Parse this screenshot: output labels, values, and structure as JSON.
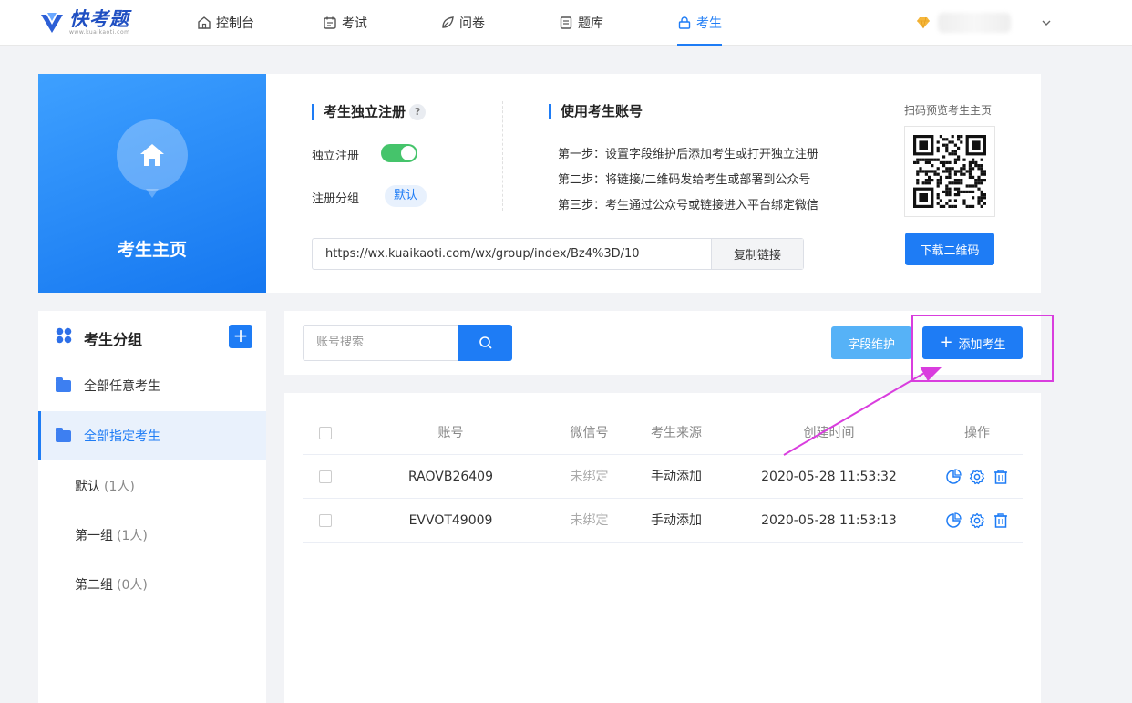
{
  "nav": {
    "logo_name": "快考题",
    "logo_sub": "www.kuaikaoti.com",
    "items": [
      {
        "label": "控制台",
        "icon": "home-icon"
      },
      {
        "label": "考试",
        "icon": "calendar-icon"
      },
      {
        "label": "问卷",
        "icon": "leaf-icon"
      },
      {
        "label": "题库",
        "icon": "book-icon"
      },
      {
        "label": "考生",
        "icon": "lock-icon",
        "active": true
      }
    ]
  },
  "hero": {
    "title": "考生主页",
    "register_title": "考生独立注册",
    "help": "?",
    "self_register_label": "独立注册",
    "register_group_label": "注册分组",
    "register_group_value": "默认",
    "account_title": "使用考生账号",
    "steps": [
      "第一步：设置字段维护后添加考生或打开独立注册",
      "第二步：将链接/二维码发给考生或部署到公众号",
      "第三步：考生通过公众号或链接进入平台绑定微信"
    ],
    "url": "https://wx.kuaikaoti.com/wx/group/index/Bz4%3D/10",
    "copy_label": "复制链接",
    "qr_caption": "扫码预览考生主页",
    "qr_button": "下载二维码"
  },
  "sidebar": {
    "title": "考生分组",
    "add": "+",
    "items": [
      {
        "label": "全部任意考生"
      },
      {
        "label": "全部指定考生",
        "active": true
      }
    ],
    "groups": [
      {
        "label": "默认",
        "count": "(1人)"
      },
      {
        "label": "第一组",
        "count": "(1人)"
      },
      {
        "label": "第二组",
        "count": "(0人)"
      }
    ]
  },
  "toolbar": {
    "search_placeholder": "账号搜索",
    "field_button": "字段维护",
    "add_button": "添加考生",
    "add_plus": "+"
  },
  "table": {
    "headers": [
      "账号",
      "微信号",
      "考生来源",
      "创建时间",
      "操作"
    ],
    "rows": [
      {
        "account": "RAOVB26409",
        "wechat": "未绑定",
        "source": "手动添加",
        "created": "2020-05-28 11:53:32"
      },
      {
        "account": "EVVOT49009",
        "wechat": "未绑定",
        "source": "手动添加",
        "created": "2020-05-28 11:53:13"
      }
    ]
  },
  "colors": {
    "primary": "#1e7cf5",
    "toggle_on": "#45c46b",
    "annotation": "#d93dde"
  }
}
